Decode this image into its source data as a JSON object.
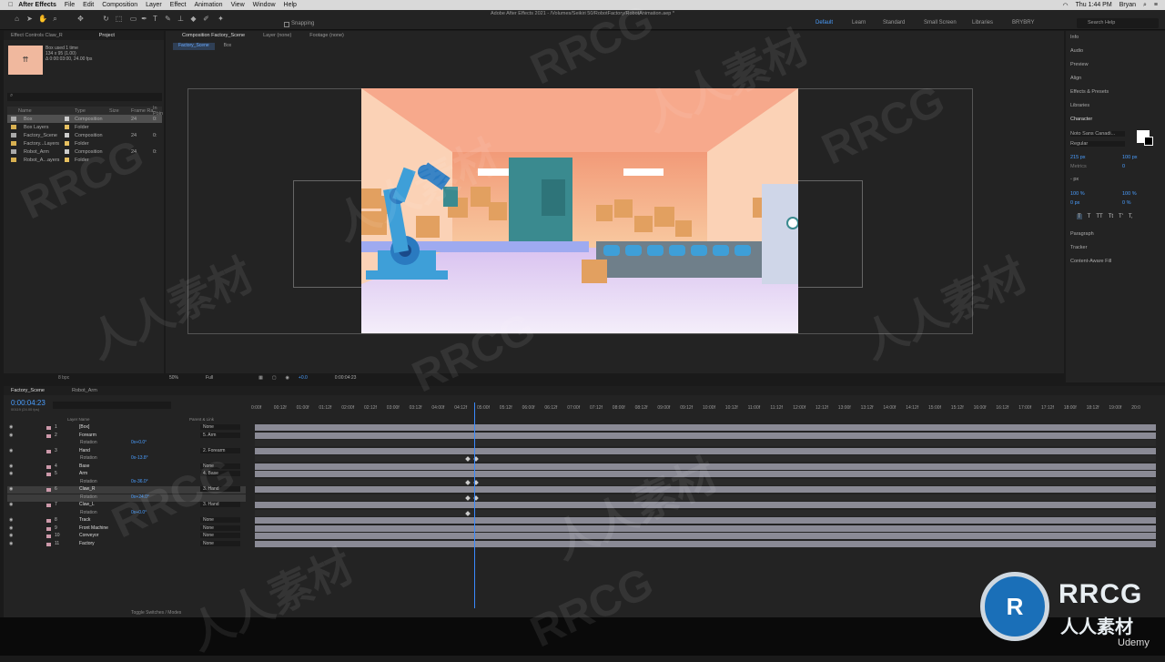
{
  "menubar": {
    "app": "After Effects",
    "items": [
      "File",
      "Edit",
      "Composition",
      "Layer",
      "Effect",
      "Animation",
      "View",
      "Window",
      "Help"
    ],
    "clock": "Thu 1:44 PM",
    "user": "Bryan"
  },
  "toolbar": {
    "title": "Adobe After Effects 2021 - /Volumes/Seikiri 50/RobotFactory/RobotAnimation.aep *",
    "snapping": "Snapping",
    "workspaces": [
      "Default",
      "Learn",
      "Standard",
      "Small Screen",
      "Libraries",
      "BRYBRY"
    ],
    "search": "Search Help"
  },
  "project": {
    "tabs": [
      "Effect Controls Claw_R",
      "Project"
    ],
    "item_name": "Box",
    "item_used": "used 1 time",
    "item_info1": "134 x 95 (1.00)",
    "item_info2": "Δ 0:00:03:00, 24.00 fps",
    "columns": [
      "Name",
      "Type",
      "Size",
      "Frame Ra...",
      "In Poin"
    ],
    "rows": [
      {
        "name": "Box",
        "type": "Composition",
        "size": "",
        "fps": "24",
        "in": "0:"
      },
      {
        "name": "Box Layers",
        "type": "Folder",
        "size": "",
        "fps": "",
        "in": ""
      },
      {
        "name": "Factory_Scene",
        "type": "Composition",
        "size": "",
        "fps": "24",
        "in": "0:"
      },
      {
        "name": "Factory...Layers",
        "type": "Folder",
        "size": "",
        "fps": "",
        "in": ""
      },
      {
        "name": "Robot_Arm",
        "type": "Composition",
        "size": "",
        "fps": "24",
        "in": "0:"
      },
      {
        "name": "Robot_A...ayers",
        "type": "Folder",
        "size": "",
        "fps": "",
        "in": ""
      }
    ],
    "bpc": "8 bpc"
  },
  "viewer": {
    "tabs": [
      "Composition Factory_Scene",
      "Layer (none)",
      "Footage (none)"
    ],
    "breadcrumbs": [
      "Factory_Scene",
      "Box"
    ],
    "zoom": "50%",
    "quality": "Full",
    "time": "0:00:04:23",
    "exposure": "+0.0"
  },
  "right": {
    "panels": [
      "Info",
      "Audio",
      "Preview",
      "Align",
      "Effects & Presets",
      "Libraries",
      "Character"
    ],
    "font": "Noto Sans Canadi...",
    "style": "Regular",
    "size": "215 px",
    "leading": "100 px",
    "metrics": "Metrics",
    "tracking": "0",
    "px": "- px",
    "vscale": "100 %",
    "hscale": "100 %",
    "baseline": "0 px",
    "tsume": "0 %",
    "type_styles": [
      "T",
      "T",
      "TT",
      "Tt",
      "T'",
      "T,"
    ],
    "panels2": [
      "Paragraph",
      "Tracker",
      "Content-Aware Fill"
    ]
  },
  "timeline": {
    "tabs": [
      "Factory_Scene",
      "Robot_Arm"
    ],
    "timecode": "0:00:04:23",
    "fps": "00119 (24.00 fps)",
    "col_layername": "Layer Name",
    "col_parent": "Parent & Link",
    "toggle": "Toggle Switches / Modes",
    "ruler": [
      "0:00f",
      "00:12f",
      "01:00f",
      "01:12f",
      "02:00f",
      "02:12f",
      "03:00f",
      "03:12f",
      "04:00f",
      "04:12f",
      "05:00f",
      "05:12f",
      "06:00f",
      "06:12f",
      "07:00f",
      "07:12f",
      "08:00f",
      "08:12f",
      "09:00f",
      "09:12f",
      "10:00f",
      "10:12f",
      "11:00f",
      "11:12f",
      "12:00f",
      "12:12f",
      "13:00f",
      "13:12f",
      "14:00f",
      "14:12f",
      "15:00f",
      "15:12f",
      "16:00f",
      "16:12f",
      "17:00f",
      "17:12f",
      "18:00f",
      "18:12f",
      "19:00f",
      "20:0"
    ],
    "layers": [
      {
        "num": "1",
        "name": "[Box]",
        "parent": "None",
        "type": "layer"
      },
      {
        "num": "2",
        "name": "Forearm",
        "parent": "5. Arm",
        "type": "layer"
      },
      {
        "num": "",
        "name": "Rotation",
        "value": "0x+0.0°",
        "type": "prop"
      },
      {
        "num": "3",
        "name": "Hand",
        "parent": "2. Forearm",
        "type": "layer"
      },
      {
        "num": "",
        "name": "Rotation",
        "value": "0x-13.8°",
        "type": "prop"
      },
      {
        "num": "4",
        "name": "Base",
        "parent": "None",
        "type": "layer"
      },
      {
        "num": "5",
        "name": "Arm",
        "parent": "4. Base",
        "type": "layer"
      },
      {
        "num": "",
        "name": "Rotation",
        "value": "0x-36.0°",
        "type": "prop"
      },
      {
        "num": "6",
        "name": "Claw_R",
        "parent": "3. Hand",
        "type": "layer"
      },
      {
        "num": "",
        "name": "Rotation",
        "value": "0x+24.0°",
        "type": "prop"
      },
      {
        "num": "7",
        "name": "Claw_L",
        "parent": "3. Hand",
        "type": "layer"
      },
      {
        "num": "",
        "name": "Rotation",
        "value": "0x+0.0°",
        "type": "prop"
      },
      {
        "num": "8",
        "name": "Track",
        "parent": "None",
        "type": "layer"
      },
      {
        "num": "9",
        "name": "Front Machine",
        "parent": "None",
        "type": "layer"
      },
      {
        "num": "10",
        "name": "Conveyor",
        "parent": "None",
        "type": "layer"
      },
      {
        "num": "11",
        "name": "Factory",
        "parent": "None",
        "type": "layer"
      }
    ]
  },
  "watermark": {
    "text1": "RRCG",
    "text2": "人人素材",
    "logo_line1": "RRCG",
    "logo_line2": "人人素材",
    "udemy": "Udemy"
  }
}
